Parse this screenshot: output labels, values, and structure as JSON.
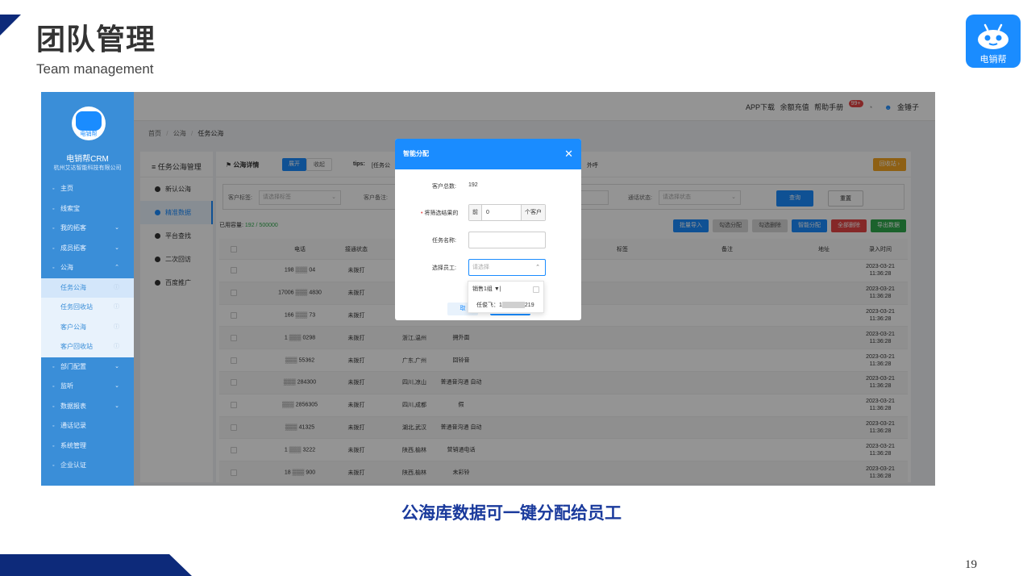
{
  "slide": {
    "title": "团队管理",
    "subtitle": "Team management",
    "logo_text": "电销帮",
    "caption": "公海库数据可一键分配给员工",
    "page_number": "19",
    "accent_color": "#0d2a7a"
  },
  "app": {
    "brand": "电销帮CRM",
    "company": "杭州艾达智能科技有限公司",
    "logo_text": "电销帮",
    "sidebar": [
      {
        "icon": "home-icon",
        "label": "主页",
        "chevron": ""
      },
      {
        "icon": "wallet-icon",
        "label": "线索宝",
        "chevron": ""
      },
      {
        "icon": "phone-icon",
        "label": "我的拓客",
        "chevron": "⌄"
      },
      {
        "icon": "people-icon",
        "label": "成员拓客",
        "chevron": "⌄"
      },
      {
        "icon": "folder-icon",
        "label": "公海",
        "chevron": "⌃"
      },
      {
        "icon": "",
        "label": "任务公海",
        "chevron": "ⓘ",
        "sub": true,
        "active": true
      },
      {
        "icon": "",
        "label": "任务回收站",
        "chevron": "ⓘ",
        "sub": true
      },
      {
        "icon": "",
        "label": "客户公海",
        "chevron": "ⓘ",
        "sub": true
      },
      {
        "icon": "",
        "label": "客户回收站",
        "chevron": "ⓘ",
        "sub": true
      },
      {
        "icon": "tool-icon",
        "label": "部门配置",
        "chevron": "⌄"
      },
      {
        "icon": "eye-icon",
        "label": "监听",
        "chevron": "⌄"
      },
      {
        "icon": "chart-icon",
        "label": "数据报表",
        "chevron": "⌄"
      },
      {
        "icon": "log-icon",
        "label": "通话记录",
        "chevron": ""
      },
      {
        "icon": "gear-icon",
        "label": "系统管理",
        "chevron": ""
      },
      {
        "icon": "badge-icon",
        "label": "企业认证",
        "chevron": ""
      }
    ],
    "topbar": {
      "app_download": "APP下载",
      "recharge": "余额充值",
      "help": "帮助手册",
      "badge": "99+",
      "user": "金锤子"
    },
    "breadcrumb": {
      "home": "首页",
      "sep": "/",
      "level1": "公海",
      "current": "任务公海"
    },
    "leftnav": {
      "header": "任务公海管理",
      "items": [
        "新认公海",
        "精准数据",
        "平台查找",
        "二次回访",
        "百度推广"
      ]
    },
    "main": {
      "header_title": "公海详情",
      "expand": "展开",
      "collapse": "收起",
      "tips_label": "tips:",
      "tips_text": "[任务公",
      "tips_tail": "外呼",
      "right_btn": "回收站 ›",
      "filters": {
        "customer_tag_label": "客户标签:",
        "customer_tag_ph": "请选择标签",
        "customer_note_label": "客户备注:",
        "call_status_label": "通话状态:",
        "call_status_ph": "请选择状态",
        "search": "查询",
        "reset": "重置"
      },
      "capacity_label": "已用容量:",
      "capacity_value": "192 / 500000",
      "actions": [
        "批量导入",
        "勾选分配",
        "勾选删除",
        "智能分配",
        "全部删除",
        "导出数据"
      ],
      "columns": [
        "电话",
        "接通状态",
        "",
        "标签",
        "备注",
        "地址",
        "录入时间"
      ],
      "rows": [
        {
          "phone": "198 ▒▒▒ 04",
          "status": "未拨打",
          "addr": "",
          "tag": "",
          "time1": "2023-03-21",
          "time2": "11:36:28"
        },
        {
          "phone": "17006 ▒▒▒ 4830",
          "status": "未拨打",
          "addr": "",
          "tag": "",
          "time1": "2023-03-21",
          "time2": "11:36:28"
        },
        {
          "phone": "166 ▒▒▒ 73",
          "status": "未拨打",
          "addr": "",
          "tag": "",
          "time1": "2023-03-21",
          "time2": "11:36:28"
        },
        {
          "phone": "1 ▒▒▒ 0298",
          "status": "未拨打",
          "addr": "浙江,温州",
          "tag": "拥外面",
          "time1": "2023-03-21",
          "time2": "11:36:28"
        },
        {
          "phone": "▒▒▒ 55362",
          "status": "未拨打",
          "addr": "广东,广州",
          "tag": "回铃音",
          "time1": "2023-03-21",
          "time2": "11:36:28"
        },
        {
          "phone": "▒▒▒ 284300",
          "status": "未拨打",
          "addr": "四川,凉山",
          "tag": "普通音沟通 自动",
          "time1": "2023-03-21",
          "time2": "11:36:28"
        },
        {
          "phone": "▒▒▒ 2856305",
          "status": "未拨打",
          "addr": "四川,成都",
          "tag": "假",
          "time1": "2023-03-21",
          "time2": "11:36:28"
        },
        {
          "phone": "▒▒▒ 41325",
          "status": "未拨打",
          "addr": "湖北,武汉",
          "tag": "普通音沟通 自动",
          "time1": "2023-03-21",
          "time2": "11:36:28"
        },
        {
          "phone": "1 ▒▒▒ 3222",
          "status": "未拨打",
          "addr": "陕西,榆林",
          "tag": "营销通电话",
          "time1": "2023-03-21",
          "time2": "11:36:28"
        },
        {
          "phone": "18 ▒▒▒ 900",
          "status": "未拨打",
          "addr": "陕西,榆林",
          "tag": "未彩铃",
          "time1": "2023-03-21",
          "time2": "11:36:28"
        }
      ]
    },
    "modal": {
      "title": "智能分配",
      "total_label": "客户总数:",
      "total_value": "192",
      "assign_label": "将筛选结果的",
      "prefix": "前",
      "count_value": "0",
      "suffix": "个客户",
      "task_label": "任务名称:",
      "task_value": "",
      "staff_label": "选择员工:",
      "staff_ph": "请选择",
      "cancel": "取",
      "options": [
        {
          "label": "销售1组 ▼|"
        },
        {
          "label": "任俊飞：1",
          "tail": "219"
        }
      ]
    }
  }
}
